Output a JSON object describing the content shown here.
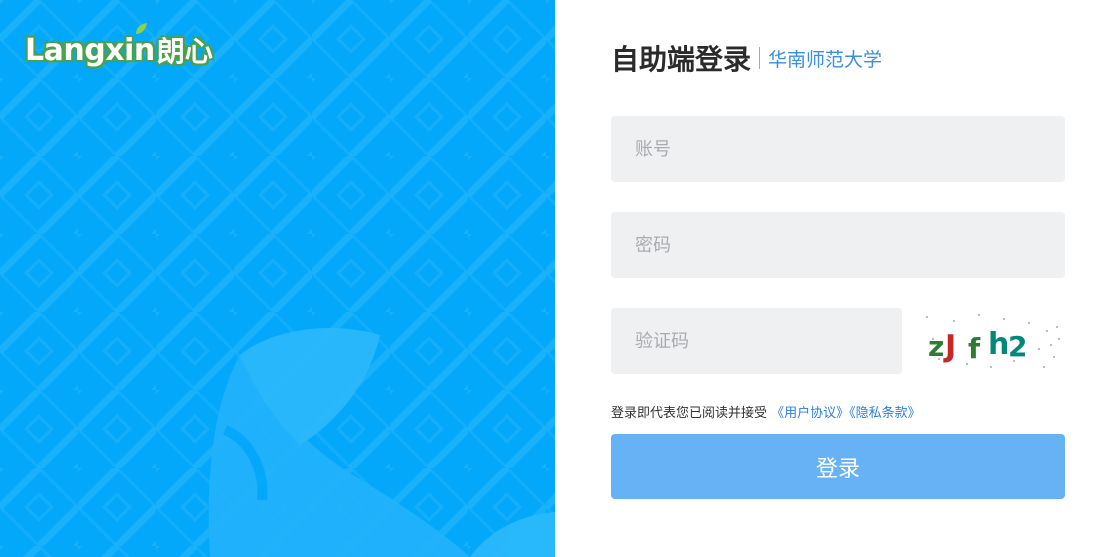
{
  "brand": {
    "logo_latin": "Langxin",
    "logo_cn": "朗心",
    "panel_color": "#04a8fb",
    "logo_outline_color": "#4aa14a"
  },
  "login": {
    "title": "自助端登录",
    "school": "华南师范大学",
    "username_placeholder": "账号",
    "password_placeholder": "密码",
    "captcha_placeholder": "验证码",
    "captcha_text": "zJfh2",
    "agreement_prefix": "登录即代表您已阅读并接受",
    "user_agreement": "《用户协议》",
    "privacy_policy": "《隐私条款》",
    "submit_label": "登录",
    "accent_color": "#3b8fe0",
    "button_color": "#67b2f4"
  }
}
